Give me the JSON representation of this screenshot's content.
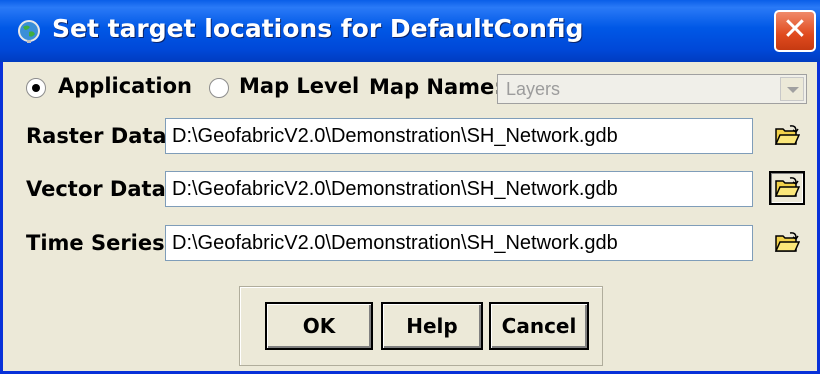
{
  "window": {
    "title": "Set target locations for DefaultConfig",
    "close_glyph": "✕"
  },
  "scope": {
    "application_label": "Application",
    "map_level_label": "Map Level",
    "selected": "Application",
    "map_name_label": "Map Name:",
    "map_name_value": "Layers"
  },
  "rows": [
    {
      "label": "Raster Data:",
      "value": "D:\\GeofabricV2.0\\Demonstration\\SH_Network.gdb",
      "icon": "open-folder-icon"
    },
    {
      "label": "Vector Data:",
      "value": "D:\\GeofabricV2.0\\Demonstration\\SH_Network.gdb",
      "icon": "open-folder-icon"
    },
    {
      "label": "Time Series:",
      "value": "D:\\GeofabricV2.0\\Demonstration\\SH_Network.gdb",
      "icon": "open-folder-icon"
    }
  ],
  "buttons": {
    "ok": "OK",
    "help": "Help",
    "cancel": "Cancel"
  },
  "colors": {
    "titlebar": "#0058e6",
    "close_button": "#e04a1e",
    "dialog_background": "#ece9d8",
    "folder": "#f2d24a"
  }
}
